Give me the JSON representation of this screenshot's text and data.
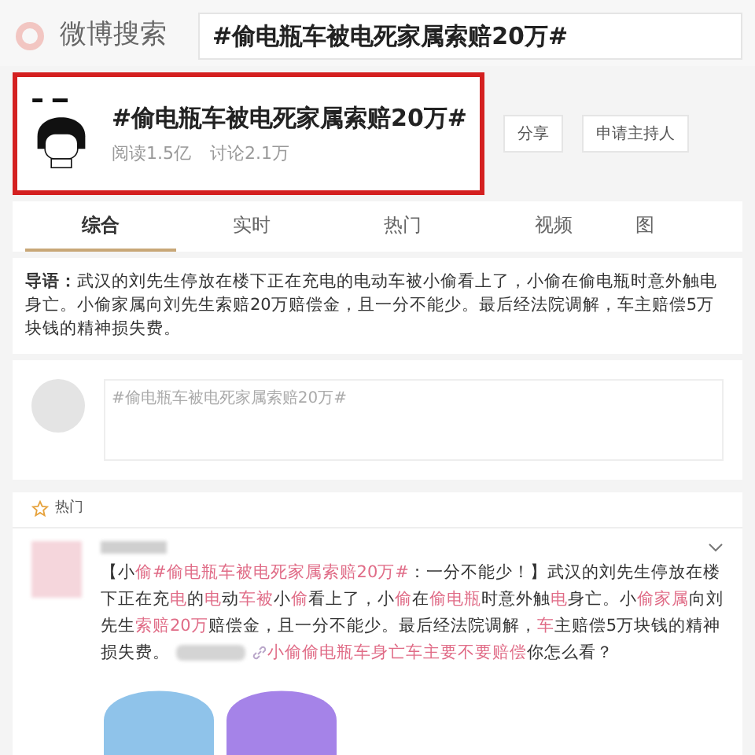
{
  "header": {
    "logo_text": "微博搜索",
    "search": {
      "value": "#偷电瓶车被电死家属索赔20万#"
    }
  },
  "topic": {
    "title": "#偷电瓶车被电死家属索赔20万#",
    "reads": "阅读1.5亿",
    "discussions": "讨论2.1万",
    "highlighted": true,
    "buttons": [
      "分享",
      "申请主持人"
    ]
  },
  "tabs": [
    {
      "label": "综合",
      "selected": true
    },
    {
      "label": "实时",
      "selected": false
    },
    {
      "label": "热门",
      "selected": false
    },
    {
      "label": "视频",
      "selected": false
    },
    {
      "label": "图",
      "selected": false
    }
  ],
  "guide": "**导语：**武汉的刘先生停放在楼下正在充电的电动车被小偷看上了，小偷在偷电瓶时意外触电身亡。小偷家属向刘先生索赔20万赔偿金，且一分不能少。最后经法院调解，车主赔偿5万块钱的精神损失费。",
  "composer": {
    "placeholder": "#偷电瓶车被电死家属索赔20万#"
  },
  "hot": {
    "label": "热门",
    "post": {
      "segments": [
        {
          "kind": "plain",
          "text": "【小"
        },
        {
          "kind": "highlight",
          "text": "偷#偷电瓶车被电死家属索赔20万#"
        },
        {
          "kind": "plain",
          "text": "：一分不能少！】武汉的刘先生停放在楼下正在充"
        },
        {
          "kind": "highlight",
          "text": "电"
        },
        {
          "kind": "plain",
          "text": "的"
        },
        {
          "kind": "highlight",
          "text": "电"
        },
        {
          "kind": "plain",
          "text": "动"
        },
        {
          "kind": "highlight",
          "text": "车被"
        },
        {
          "kind": "plain",
          "text": "小"
        },
        {
          "kind": "highlight",
          "text": "偷"
        },
        {
          "kind": "plain",
          "text": "看上了，小"
        },
        {
          "kind": "highlight",
          "text": "偷"
        },
        {
          "kind": "plain",
          "text": "在"
        },
        {
          "kind": "highlight",
          "text": "偷电瓶"
        },
        {
          "kind": "plain",
          "text": "时意外触"
        },
        {
          "kind": "highlight",
          "text": "电"
        },
        {
          "kind": "plain",
          "text": "身亡。小"
        },
        {
          "kind": "highlight",
          "text": "偷家属"
        },
        {
          "kind": "plain",
          "text": "向刘先生"
        },
        {
          "kind": "highlight",
          "text": "索赔20万"
        },
        {
          "kind": "plain",
          "text": "赔偿金，且一分不能少。最后经法院调解，"
        },
        {
          "kind": "highlight",
          "text": "车"
        },
        {
          "kind": "plain",
          "text": "主赔偿5万块钱的精神损失费。"
        },
        {
          "kind": "blurred"
        },
        {
          "kind": "link"
        },
        {
          "kind": "highlight",
          "text": "小偷偷电瓶车身亡车主要不要赔偿"
        },
        {
          "kind": "plain",
          "text": "你怎么看？"
        }
      ],
      "stickers": [
        {
          "color": "#8fc3ea"
        },
        {
          "color": "#a583e8"
        }
      ]
    }
  }
}
